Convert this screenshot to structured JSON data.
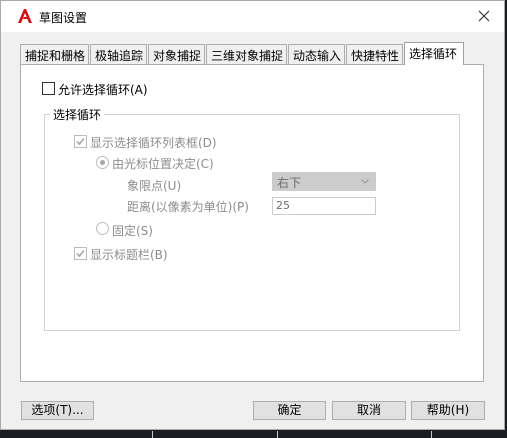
{
  "window": {
    "title": "草图设置",
    "close_symbol": "✕"
  },
  "tabs": [
    {
      "label": "捕捉和栅格"
    },
    {
      "label": "极轴追踪"
    },
    {
      "label": "对象捕捉"
    },
    {
      "label": "三维对象捕捉"
    },
    {
      "label": "动态输入"
    },
    {
      "label": "快捷特性"
    },
    {
      "label": "选择循环",
      "active": true
    }
  ],
  "panel": {
    "allow_cycling_label": "允许选择循环(A)",
    "allow_cycling_checked": false,
    "group_title": "选择循环",
    "show_list_label": "显示选择循环列表框(D)",
    "show_list_checked": true,
    "cursor_relative_label": "由光标位置决定(C)",
    "quadrant_label": "象限点(U)",
    "quadrant_value": "右下",
    "distance_label": "距离(以像素为单位)(P)",
    "distance_value": "25",
    "fixed_label": "固定(S)",
    "show_title_label": "显示标题栏(B)",
    "show_title_checked": true
  },
  "buttons": {
    "options": "选项(T)...",
    "ok": "确定",
    "cancel": "取消",
    "help": "帮助(H)"
  },
  "icons": {
    "app": "autocad-logo-icon",
    "close": "close-icon",
    "check": "checkmark-icon",
    "dropdown": "chevron-down-icon"
  },
  "colors": {
    "app_logo": "#d40f14",
    "disabled_text": "#8d8d8d",
    "background": "#f0f0f0"
  }
}
